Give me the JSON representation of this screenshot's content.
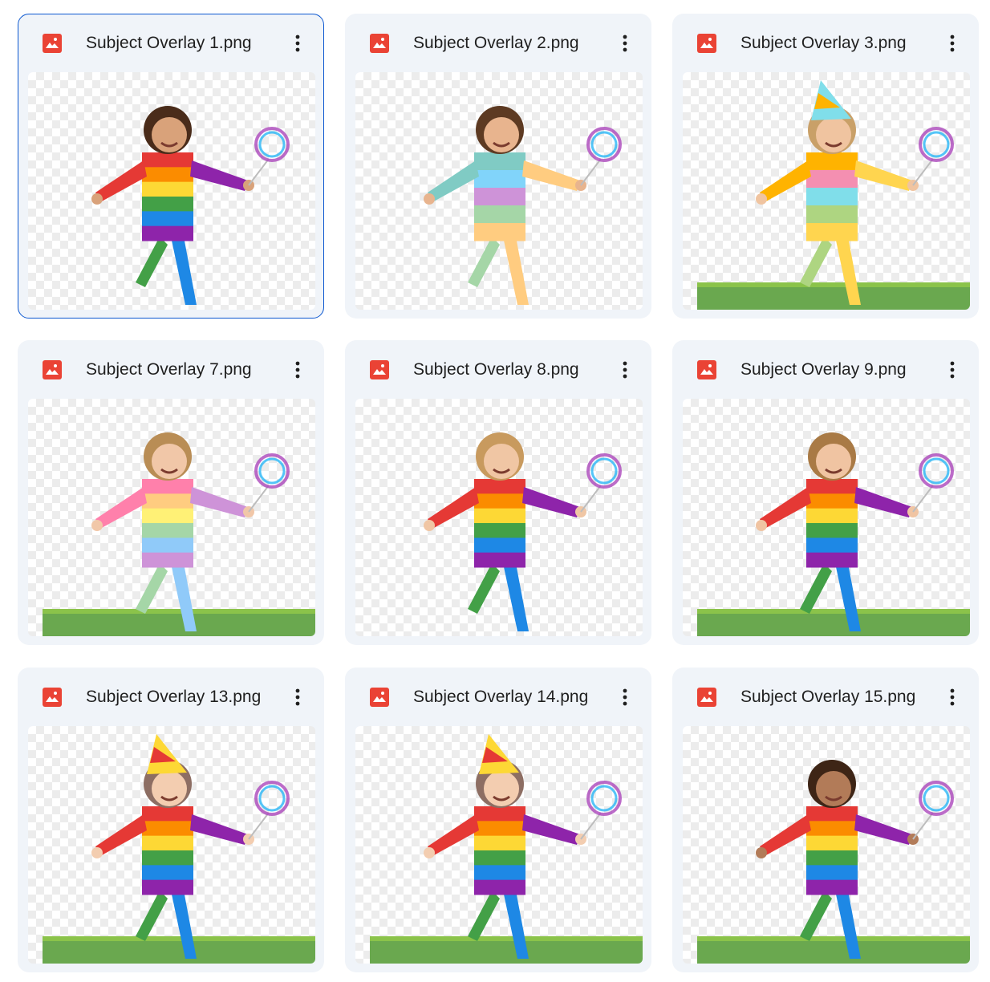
{
  "files": [
    {
      "name": "Subject Overlay 1.png",
      "selected": true,
      "grass": false,
      "hat": false,
      "stripe": [
        "#e53935",
        "#fb8c00",
        "#fdd835",
        "#43a047",
        "#1e88e5",
        "#8e24aa"
      ],
      "skin": "#d9a27a",
      "hair": "#4a2c1a"
    },
    {
      "name": "Subject Overlay 2.png",
      "selected": false,
      "grass": false,
      "hat": false,
      "stripe": [
        "#80cbc4",
        "#81d4fa",
        "#ce93d8",
        "#a5d6a7",
        "#ffcc80"
      ],
      "skin": "#e8b48e",
      "hair": "#5d3a22"
    },
    {
      "name": "Subject Overlay 3.png",
      "selected": false,
      "grass": true,
      "hat": true,
      "stripe": [
        "#ffb300",
        "#f48fb1",
        "#80deea",
        "#aed581",
        "#ffd54f"
      ],
      "skin": "#f0c4a0",
      "hair": "#c9a068"
    },
    {
      "name": "Subject Overlay 7.png",
      "selected": false,
      "grass": true,
      "hat": false,
      "stripe": [
        "#ff80ab",
        "#ffcc80",
        "#fff176",
        "#a5d6a7",
        "#90caf9",
        "#ce93d8"
      ],
      "skin": "#f1c7a8",
      "hair": "#b98d55"
    },
    {
      "name": "Subject Overlay 8.png",
      "selected": false,
      "grass": false,
      "hat": false,
      "stripe": [
        "#e53935",
        "#fb8c00",
        "#fdd835",
        "#43a047",
        "#1e88e5",
        "#8e24aa"
      ],
      "skin": "#f0c6a4",
      "hair": "#c89a5e"
    },
    {
      "name": "Subject Overlay 9.png",
      "selected": false,
      "grass": true,
      "hat": false,
      "stripe": [
        "#e53935",
        "#fb8c00",
        "#fdd835",
        "#43a047",
        "#1e88e5",
        "#8e24aa"
      ],
      "skin": "#f0c4a2",
      "hair": "#a97a45"
    },
    {
      "name": "Subject Overlay 13.png",
      "selected": false,
      "grass": true,
      "hat": true,
      "stripe": [
        "#e53935",
        "#fb8c00",
        "#fdd835",
        "#43a047",
        "#1e88e5",
        "#8e24aa"
      ],
      "skin": "#f3cdb0",
      "hair": "#8d6e63"
    },
    {
      "name": "Subject Overlay 14.png",
      "selected": false,
      "grass": true,
      "hat": true,
      "stripe": [
        "#e53935",
        "#fb8c00",
        "#fdd835",
        "#43a047",
        "#1e88e5",
        "#8e24aa"
      ],
      "skin": "#f3cdb0",
      "hair": "#8d6e63"
    },
    {
      "name": "Subject Overlay 15.png",
      "selected": false,
      "grass": true,
      "hat": false,
      "stripe": [
        "#e53935",
        "#fb8c00",
        "#fdd835",
        "#43a047",
        "#1e88e5",
        "#8e24aa"
      ],
      "skin": "#b27b58",
      "hair": "#3e2516"
    }
  ],
  "icons": {
    "file_type": "image-file-icon",
    "menu": "more-vert-icon"
  },
  "colors": {
    "file_icon": "#ea4335",
    "selected_border": "#0b57d0",
    "card_bg": "#f0f4f9"
  }
}
